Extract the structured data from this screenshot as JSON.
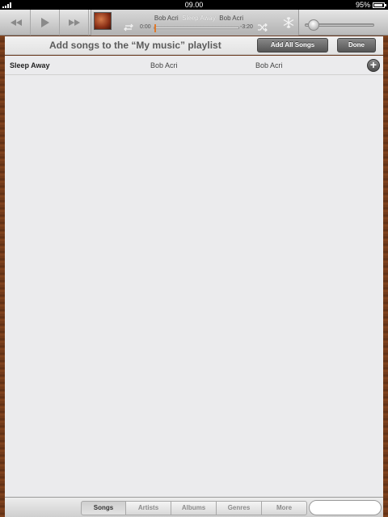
{
  "status_bar": {
    "time": "09.00",
    "battery_percent": "95%",
    "signal_bars": 4,
    "battery_level": 0.95
  },
  "player": {
    "controls": [
      "rewind-icon",
      "play-icon",
      "fast-forward-icon"
    ],
    "now_playing": {
      "artist": "Bob Acri",
      "title": "Sleep Away",
      "album": "Bob Acri",
      "elapsed": "0:00",
      "remaining": "-3:20",
      "progress": 0.0
    },
    "icons": [
      "repeat-icon",
      "shuffle-icon",
      "genius-icon"
    ],
    "volume_level": 0.1
  },
  "header": {
    "title": "Add songs to the “My music” playlist",
    "add_all_label": "Add All Songs",
    "done_label": "Done"
  },
  "songs": [
    {
      "title": "Sleep Away",
      "artist": "Bob Acri",
      "album": "Bob Acri"
    }
  ],
  "bottom_bar": {
    "tabs": [
      "Songs",
      "Artists",
      "Albums",
      "Genres",
      "More"
    ],
    "active_tab": "Songs",
    "search_placeholder": ""
  },
  "colors": {
    "accent_scrubber": "#e0792a",
    "list_background": "#ebebed",
    "wood_border": "#6b3a1f"
  }
}
